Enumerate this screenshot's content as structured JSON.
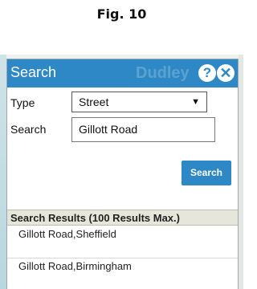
{
  "figure": {
    "caption": "Fig. 10"
  },
  "panel": {
    "title": "Search",
    "map_watermark": "Dudley",
    "help_glyph": "?",
    "close_glyph": "✕"
  },
  "form": {
    "type_label": "Type",
    "type_value": "Street",
    "search_label": "Search",
    "search_value": "Gillott Road",
    "search_button": "Search"
  },
  "results": {
    "header": "Search Results (100 Results Max.)",
    "items": [
      {
        "label": "Gillott Road,Sheffield"
      },
      {
        "label": "Gillott Road,Birmingham"
      }
    ]
  },
  "colors": {
    "accent": "#2d88c5",
    "results_header_bg": "#e6e6db"
  }
}
